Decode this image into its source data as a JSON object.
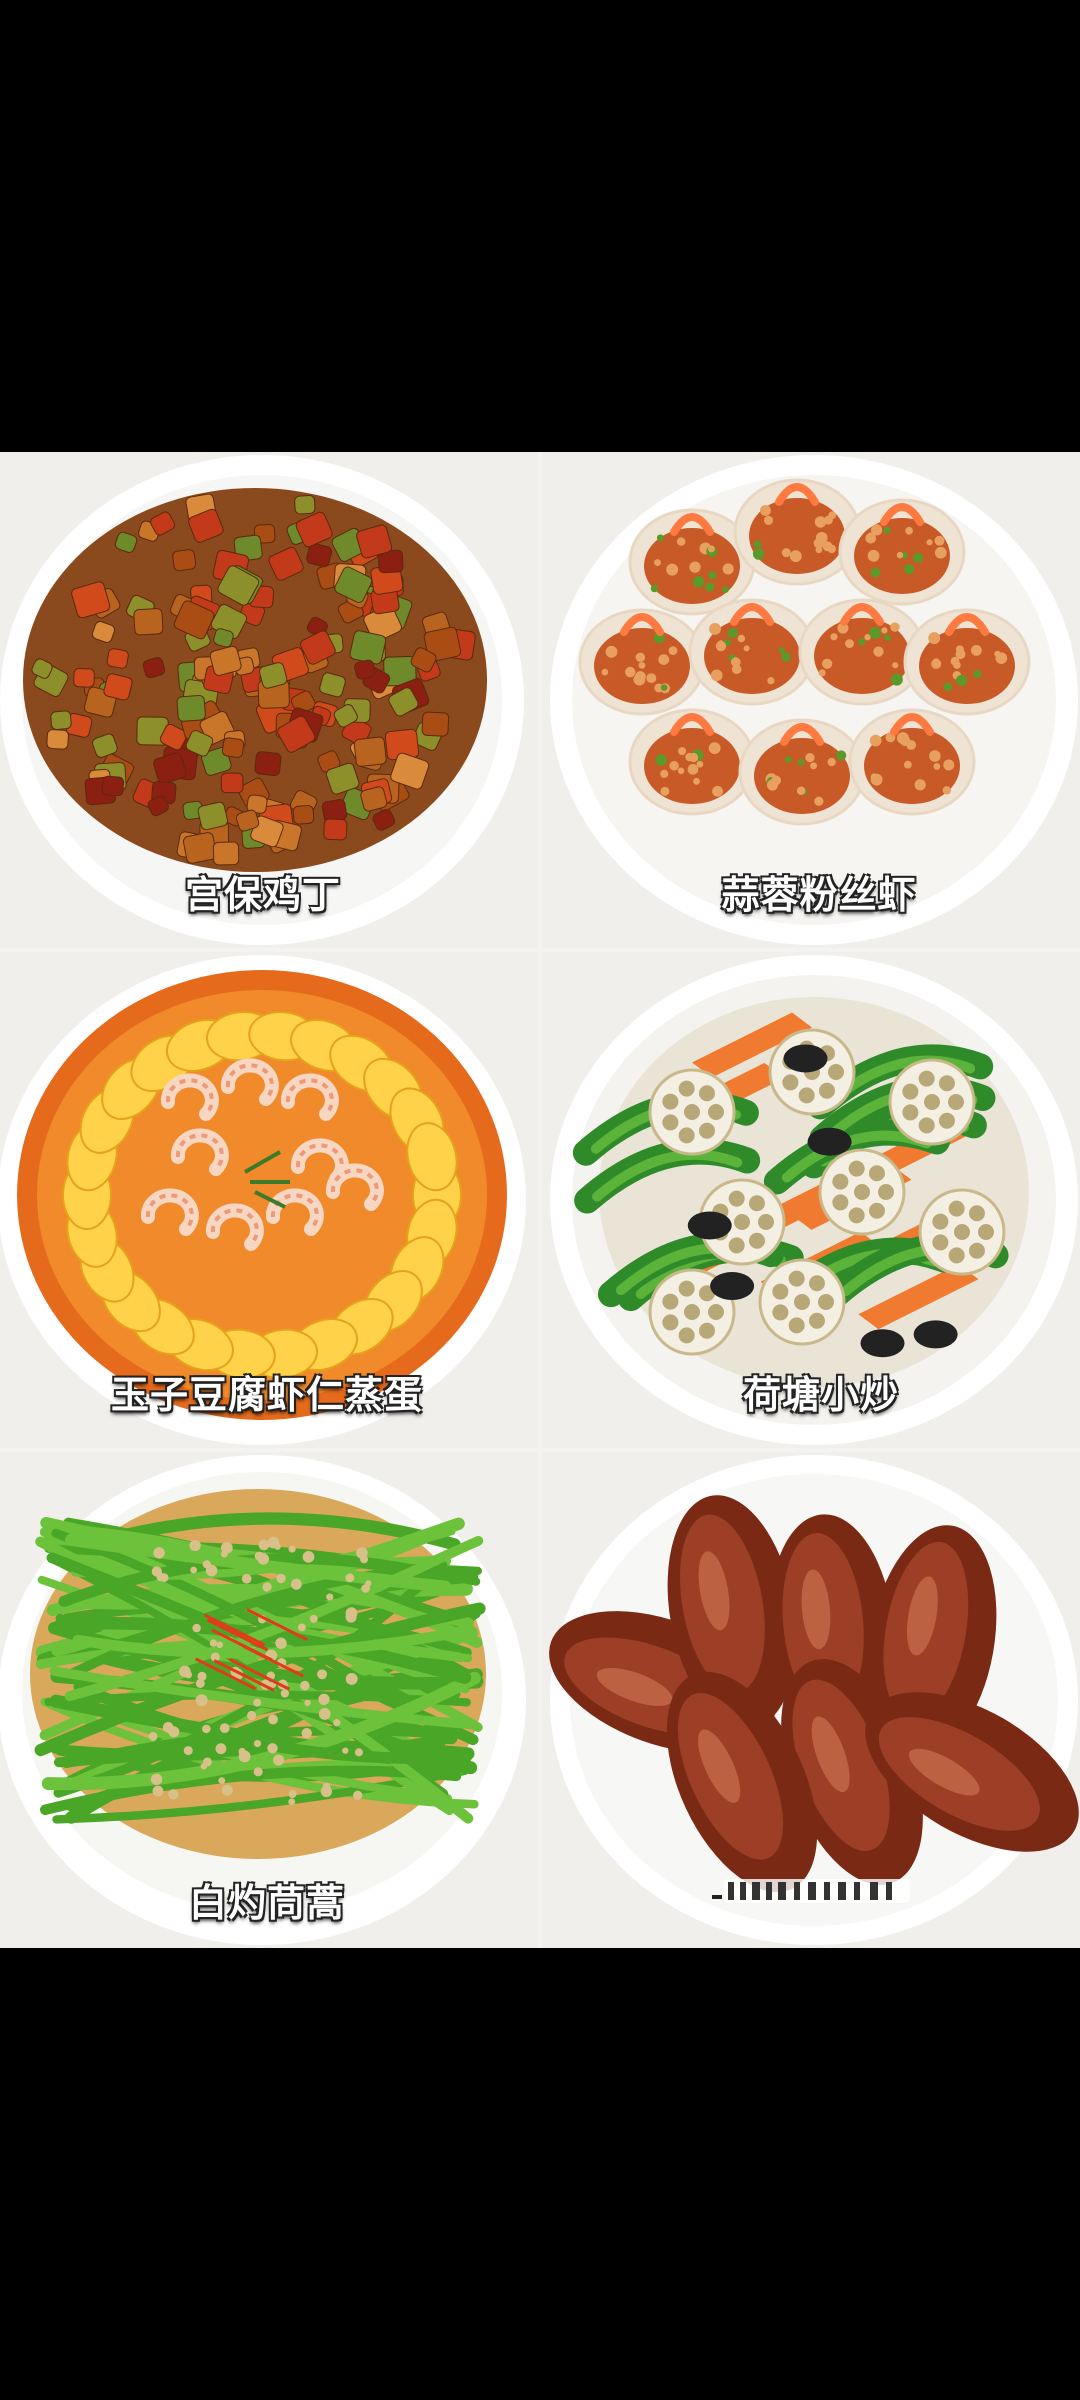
{
  "image": {
    "background": "#000000",
    "dishes": [
      {
        "label": "宫保鸡丁",
        "icon": "kung-pao-chicken"
      },
      {
        "label": "蒜蓉粉丝虾",
        "icon": "garlic-vermicelli-shrimp"
      },
      {
        "label": "玉子豆腐虾仁蒸蛋",
        "icon": "tofu-shrimp-steamed-egg"
      },
      {
        "label": "荷塘小炒",
        "icon": "lotus-pond-stir-fry"
      },
      {
        "label": "白灼茼蒿",
        "icon": "blanched-chrysanthemum-greens"
      },
      {
        "label": "",
        "icon": "braised-chicken-wings"
      }
    ]
  }
}
